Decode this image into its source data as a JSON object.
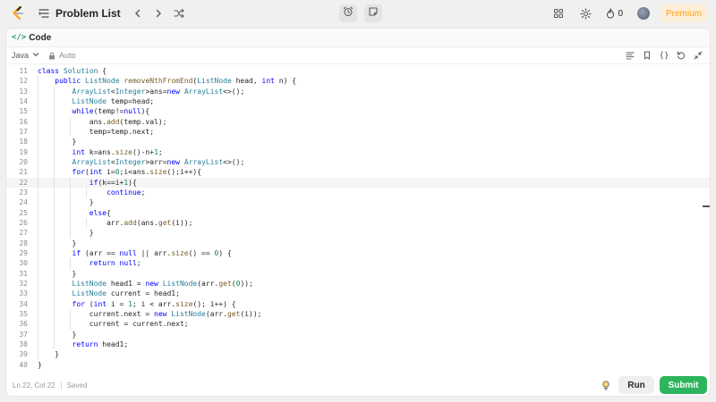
{
  "nav": {
    "title": "Problem List",
    "streak_count": "0",
    "premium_label": "Premium"
  },
  "panel": {
    "title": "Code"
  },
  "editor_toolbar": {
    "language": "Java",
    "mode": "Auto"
  },
  "code": {
    "active_line": 22,
    "lines": [
      {
        "n": "11",
        "html": "<span class=\"kw\">class</span> <span class=\"ty\">Solution</span> {"
      },
      {
        "n": "12",
        "html": "    <span class=\"kw\">public</span> <span class=\"ty\">ListNode</span> <span class=\"fn\">removeNthFromEnd</span>(<span class=\"ty\">ListNode</span> head, <span class=\"kw\">int</span> n) {"
      },
      {
        "n": "13",
        "html": "        <span class=\"ty\">ArrayList</span>&lt;<span class=\"ty\">Integer</span>&gt;ans=<span class=\"kw\">new</span> <span class=\"ty\">ArrayList</span>&lt;&gt;();"
      },
      {
        "n": "14",
        "html": "        <span class=\"ty\">ListNode</span> temp=head;"
      },
      {
        "n": "15",
        "html": "        <span class=\"kw\">while</span>(temp!=<span class=\"kw\">null</span>){"
      },
      {
        "n": "16",
        "html": "            ans.<span class=\"fn\">add</span>(temp.val);"
      },
      {
        "n": "17",
        "html": "            temp=temp.next;"
      },
      {
        "n": "18",
        "html": "        }"
      },
      {
        "n": "19",
        "html": "        <span class=\"kw\">int</span> k=ans.<span class=\"fn\">size</span>()-n+<span class=\"num\">1</span>;"
      },
      {
        "n": "20",
        "html": "        <span class=\"ty\">ArrayList</span>&lt;<span class=\"ty\">Integer</span>&gt;arr=<span class=\"kw\">new</span> <span class=\"ty\">ArrayList</span>&lt;&gt;();"
      },
      {
        "n": "21",
        "html": "        <span class=\"kw\">for</span>(<span class=\"kw\">int</span> i=<span class=\"num\">0</span>;i&lt;ans.<span class=\"fn\">size</span>();i++){"
      },
      {
        "n": "22",
        "html": "            <span class=\"kw\">if</span>(k==i+<span class=\"num\">1</span>){"
      },
      {
        "n": "23",
        "html": "                <span class=\"kw\">continue</span>;"
      },
      {
        "n": "24",
        "html": "            }"
      },
      {
        "n": "25",
        "html": "            <span class=\"kw\">else</span>{"
      },
      {
        "n": "26",
        "html": "                arr.<span class=\"fn\">add</span>(ans.<span class=\"fn\">get</span>(i));"
      },
      {
        "n": "27",
        "html": "            }"
      },
      {
        "n": "28",
        "html": "        }"
      },
      {
        "n": "29",
        "html": "        <span class=\"kw\">if</span> (arr == <span class=\"kw\">null</span> || arr.<span class=\"fn\">size</span>() == <span class=\"num\">0</span>) {"
      },
      {
        "n": "30",
        "html": "            <span class=\"kw\">return</span> <span class=\"kw\">null</span>;"
      },
      {
        "n": "31",
        "html": "        }"
      },
      {
        "n": "32",
        "html": "        <span class=\"ty\">ListNode</span> head1 = <span class=\"kw\">new</span> <span class=\"ty\">ListNode</span>(arr.<span class=\"fn\">get</span>(<span class=\"num\">0</span>));"
      },
      {
        "n": "33",
        "html": "        <span class=\"ty\">ListNode</span> current = head1;"
      },
      {
        "n": "34",
        "html": "        <span class=\"kw\">for</span> (<span class=\"kw\">int</span> i = <span class=\"num\">1</span>; i &lt; arr.<span class=\"fn\">size</span>(); i++) {"
      },
      {
        "n": "35",
        "html": "            current.next = <span class=\"kw\">new</span> <span class=\"ty\">ListNode</span>(arr.<span class=\"fn\">get</span>(i));"
      },
      {
        "n": "36",
        "html": "            current = current.next;"
      },
      {
        "n": "37",
        "html": "        }"
      },
      {
        "n": "38",
        "html": "        <span class=\"kw\">return</span> head1;"
      },
      {
        "n": "39",
        "html": "    }"
      },
      {
        "n": "40",
        "html": "}"
      }
    ]
  },
  "status": {
    "cursor": "Ln 22, Col 22",
    "saved": "Saved"
  },
  "actions": {
    "run_label": "Run",
    "submit_label": "Submit"
  },
  "colors": {
    "accent": "#ffa116",
    "submit": "#2db55d",
    "keyword": "#0000ff",
    "type": "#267f99",
    "function": "#795e26",
    "number": "#098658"
  }
}
